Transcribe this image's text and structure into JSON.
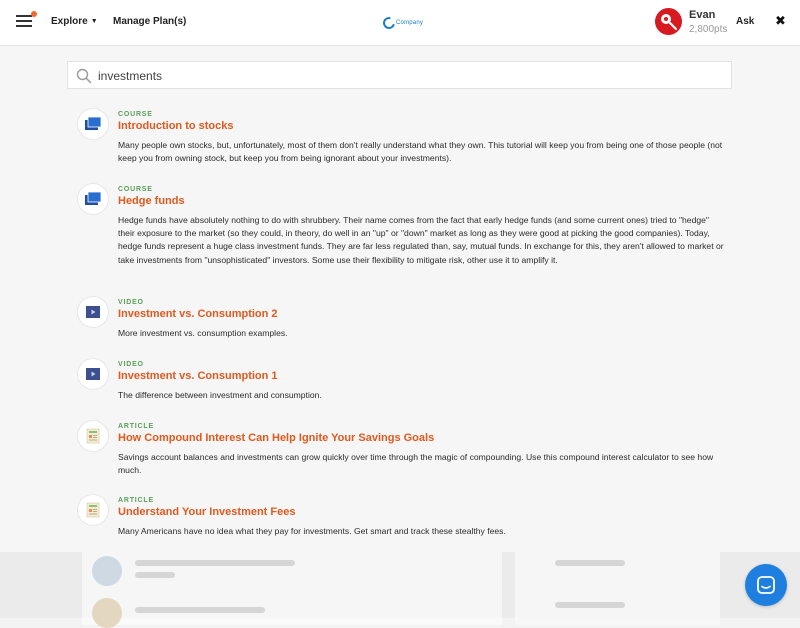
{
  "header": {
    "explore_label": "Explore",
    "manage_plans_label": "Manage Plan(s)",
    "logo_text": "Company",
    "user_name": "Evan",
    "user_points": "2,800pts",
    "ask_label": "Ask",
    "icons": {
      "menu": "hamburger-menu-icon",
      "close": "close-icon",
      "avatar": "pin-avatar-icon"
    }
  },
  "search": {
    "query": "investments",
    "icon": "search-icon"
  },
  "results": [
    {
      "type": "COURSE",
      "title": "Introduction to stocks",
      "description": "Many people own stocks, but, unfortunately, most of them don't really understand what they own. This tutorial will keep you from being one of those people (not keep you from owning stock, but keep you from being ignorant about your investments).",
      "icon": "course-icon"
    },
    {
      "type": "COURSE",
      "title": "Hedge funds",
      "description": "Hedge funds have absolutely nothing to do with shrubbery. Their name comes from the fact that early hedge funds (and some current ones) tried to \"hedge\" their exposure to the market (so they could, in theory, do well in an \"up\" or \"down\" market as long as they were good at picking the good companies). Today, hedge funds represent a huge class investment funds.  They are far less regulated than, say, mutual funds. In exchange for this, they aren't allowed to market or take investments from \"unsophisticated\" investors. Some use their flexibility to mitigate risk, other use it to amplify it.",
      "icon": "course-icon"
    },
    {
      "type": "VIDEO",
      "title": "Investment vs. Consumption 2",
      "description": "More investment vs. consumption examples.",
      "icon": "video-icon"
    },
    {
      "type": "VIDEO",
      "title": "Investment vs. Consumption 1",
      "description": "The difference between investment and consumption.",
      "icon": "video-icon"
    },
    {
      "type": "ARTICLE",
      "title": "How Compound Interest Can Help Ignite Your Savings Goals",
      "description": "Savings account balances and investments can grow quickly over time through the magic of compounding. Use this compound interest calculator to see how much.",
      "icon": "article-icon"
    },
    {
      "type": "ARTICLE",
      "title": "Understand Your Investment Fees",
      "description": "Many Americans have no idea what they pay for investments. Get smart and track these stealthy fees.",
      "icon": "article-icon"
    }
  ],
  "chat": {
    "icon": "chat-icon"
  },
  "colors": {
    "accent_orange": "#e0591e",
    "type_green": "#5aa05a",
    "chat_blue": "#1f7fe0",
    "avatar_red": "#d71920"
  }
}
